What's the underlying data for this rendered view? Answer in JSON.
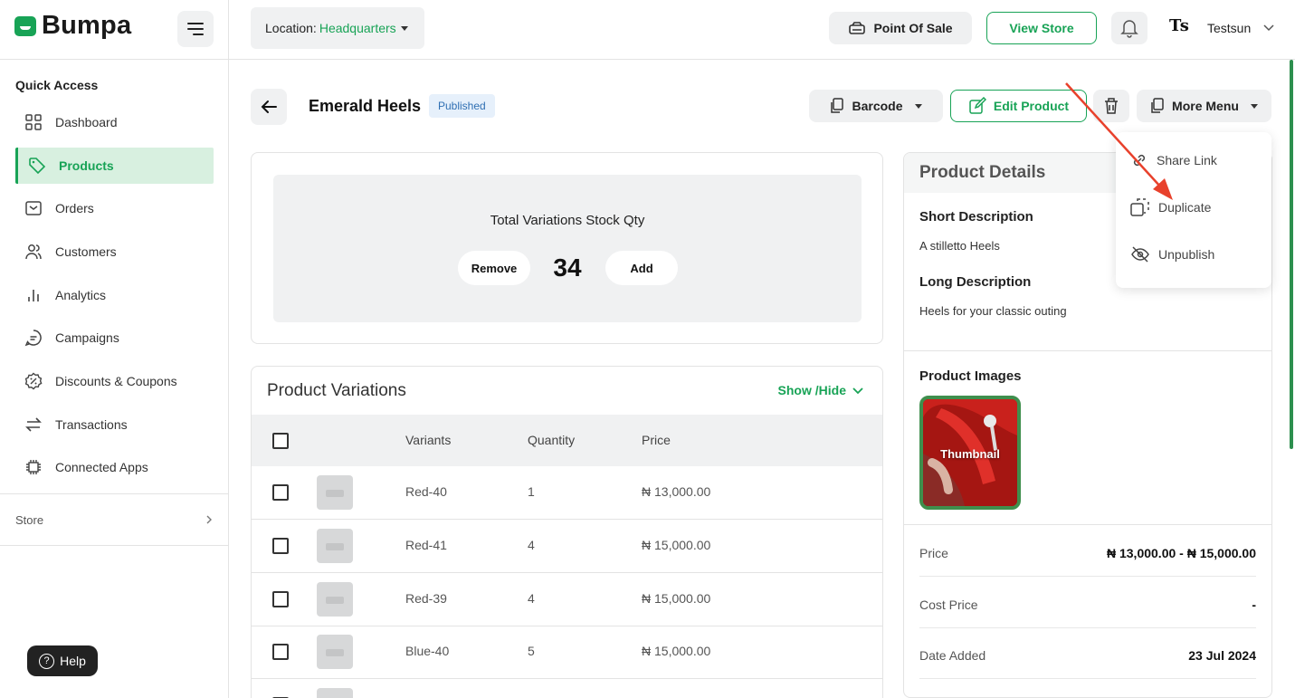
{
  "brand": {
    "name": "Bumpa",
    "accent": "#18a356"
  },
  "topbar": {
    "location_label": "Location:",
    "location_value": "Headquarters",
    "pos_label": "Point Of Sale",
    "view_store_label": "View Store",
    "user_initials": "Ts",
    "user_name": "Testsun"
  },
  "sidebar": {
    "section_title": "Quick Access",
    "items": [
      {
        "label": "Dashboard",
        "icon": "dashboard-icon"
      },
      {
        "label": "Products",
        "icon": "tag-icon",
        "active": true
      },
      {
        "label": "Orders",
        "icon": "orders-icon"
      },
      {
        "label": "Customers",
        "icon": "customers-icon"
      },
      {
        "label": "Analytics",
        "icon": "analytics-icon"
      },
      {
        "label": "Campaigns",
        "icon": "campaigns-icon"
      },
      {
        "label": "Discounts & Coupons",
        "icon": "discount-icon"
      },
      {
        "label": "Transactions",
        "icon": "transactions-icon"
      },
      {
        "label": "Connected Apps",
        "icon": "connected-apps-icon"
      }
    ],
    "store_label": "Store",
    "help_label": "Help"
  },
  "product": {
    "title": "Emerald Heels",
    "status": "Published",
    "barcode_label": "Barcode",
    "edit_label": "Edit Product",
    "more_label": "More Menu"
  },
  "stock": {
    "label": "Total Variations Stock Qty",
    "remove_label": "Remove",
    "quantity": "34",
    "add_label": "Add"
  },
  "variations": {
    "title": "Product Variations",
    "toggle_label": "Show /Hide",
    "columns": [
      "Variants",
      "Quantity",
      "Price"
    ],
    "rows": [
      {
        "variant": "Red-40",
        "quantity": "1",
        "price": "₦ 13,000.00"
      },
      {
        "variant": "Red-41",
        "quantity": "4",
        "price": "₦ 15,000.00"
      },
      {
        "variant": "Red-39",
        "quantity": "4",
        "price": "₦ 15,000.00"
      },
      {
        "variant": "Blue-40",
        "quantity": "5",
        "price": "₦ 15,000.00"
      }
    ]
  },
  "details": {
    "title": "Product Details",
    "short_desc_label": "Short Description",
    "short_desc": "A stilletto Heels",
    "long_desc_label": "Long Description",
    "long_desc": "Heels for your classic outing",
    "images_label": "Product Images",
    "thumbnail_label": "Thumbnail",
    "price_label": "Price",
    "price_value": "₦ 13,000.00 - ₦ 15,000.00",
    "cost_label": "Cost Price",
    "cost_value": "-",
    "date_label": "Date Added",
    "date_value": "23 Jul 2024"
  },
  "more_menu": {
    "items": [
      {
        "label": "Share Link",
        "icon": "link-icon"
      },
      {
        "label": "Duplicate",
        "icon": "duplicate-icon"
      },
      {
        "label": "Unpublish",
        "icon": "eye-off-icon"
      }
    ]
  },
  "annotation": {
    "color": "#e8412c"
  }
}
